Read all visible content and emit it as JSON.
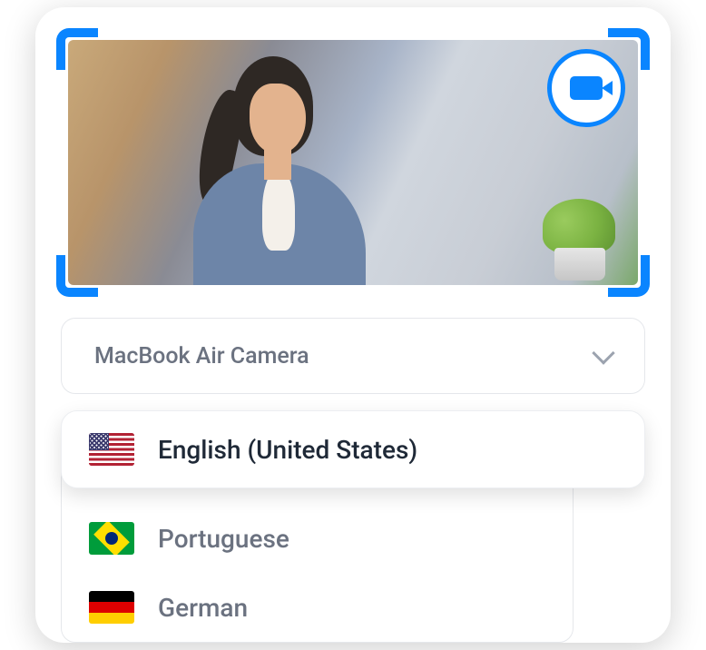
{
  "camera": {
    "dropdown_label": "MacBook Air Camera"
  },
  "languages": {
    "selected": {
      "label": "English (United States)",
      "flag": "us"
    },
    "options": [
      {
        "label": "Portuguese",
        "flag": "br"
      },
      {
        "label": "German",
        "flag": "de"
      }
    ]
  },
  "colors": {
    "accent": "#0a85ff"
  }
}
